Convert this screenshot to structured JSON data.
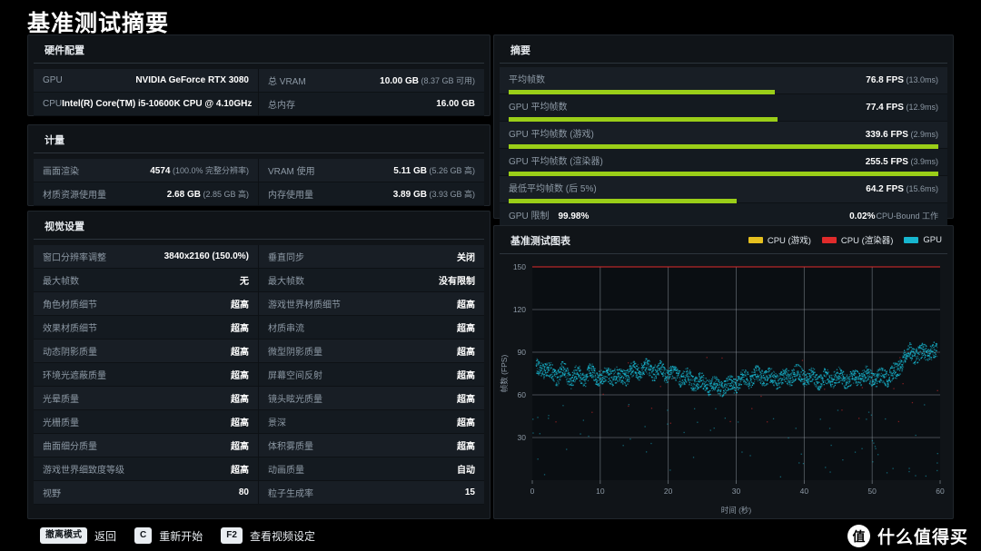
{
  "page_title": "基准测试摘要",
  "hardware": {
    "title": "硬件配置",
    "rows": [
      {
        "k": "GPU",
        "v": "NVIDIA GeForce RTX 3080",
        "sub": ""
      },
      {
        "k": "总 VRAM",
        "v": "10.00 GB",
        "sub": "(8.37 GB 可用)"
      },
      {
        "k": "CPU",
        "v": "Intel(R) Core(TM) i5-10600K CPU @ 4.10GHz",
        "sub": ""
      },
      {
        "k": "总内存",
        "v": "16.00 GB",
        "sub": ""
      }
    ]
  },
  "metrics": {
    "title": "计量",
    "rows": [
      {
        "k": "画面渲染",
        "v": "4574",
        "sub": "(100.0% 完整分辨率)"
      },
      {
        "k": "VRAM 使用",
        "v": "5.11 GB",
        "sub": "(5.26 GB 高)"
      },
      {
        "k": "材质资源使用量",
        "v": "2.68 GB",
        "sub": "(2.85 GB 高)"
      },
      {
        "k": "内存使用量",
        "v": "3.89 GB",
        "sub": "(3.93 GB 高)"
      }
    ]
  },
  "visual": {
    "title": "视觉设置",
    "rows": [
      {
        "k": "窗口分辨率调整",
        "v": "3840x2160 (150.0%)",
        "sub": ""
      },
      {
        "k": "垂直同步",
        "v": "关闭",
        "sub": ""
      },
      {
        "k": "最大帧数",
        "v": "无",
        "sub": ""
      },
      {
        "k": "最大帧数",
        "v": "没有限制",
        "sub": ""
      },
      {
        "k": "角色材质细节",
        "v": "超高",
        "sub": ""
      },
      {
        "k": "游戏世界材质细节",
        "v": "超高",
        "sub": ""
      },
      {
        "k": "效果材质细节",
        "v": "超高",
        "sub": ""
      },
      {
        "k": "材质串流",
        "v": "超高",
        "sub": ""
      },
      {
        "k": "动态阴影质量",
        "v": "超高",
        "sub": ""
      },
      {
        "k": "微型阴影质量",
        "v": "超高",
        "sub": ""
      },
      {
        "k": "环境光遮蔽质量",
        "v": "超高",
        "sub": ""
      },
      {
        "k": "屏幕空间反射",
        "v": "超高",
        "sub": ""
      },
      {
        "k": "光晕质量",
        "v": "超高",
        "sub": ""
      },
      {
        "k": "镜头眩光质量",
        "v": "超高",
        "sub": ""
      },
      {
        "k": "光栅质量",
        "v": "超高",
        "sub": ""
      },
      {
        "k": "景深",
        "v": "超高",
        "sub": ""
      },
      {
        "k": "曲面细分质量",
        "v": "超高",
        "sub": ""
      },
      {
        "k": "体积雾质量",
        "v": "超高",
        "sub": ""
      },
      {
        "k": "游戏世界细致度等级",
        "v": "超高",
        "sub": ""
      },
      {
        "k": "动画质量",
        "v": "自动",
        "sub": ""
      },
      {
        "k": "视野",
        "v": "80",
        "sub": ""
      },
      {
        "k": "粒子生成率",
        "v": "15",
        "sub": ""
      }
    ]
  },
  "summary": {
    "title": "摘要",
    "rows": [
      {
        "label": "平均帧数",
        "value": "76.8 FPS",
        "ms": "(13.0ms)",
        "pct": "",
        "bar": 62.0,
        "color": "green"
      },
      {
        "label": "GPU 平均帧数",
        "value": "77.4 FPS",
        "ms": "(12.9ms)",
        "pct": "",
        "bar": 62.5,
        "color": "green"
      },
      {
        "label": "GPU 平均帧数 (游戏)",
        "value": "339.6 FPS",
        "ms": "(2.9ms)",
        "pct": "",
        "bar": 100.0,
        "color": "green"
      },
      {
        "label": "GPU 平均帧数 (渲染器)",
        "value": "255.5 FPS",
        "ms": "(3.9ms)",
        "pct": "",
        "bar": 100.0,
        "color": "green"
      },
      {
        "label": "最低平均帧数 (后 5%)",
        "value": "64.2 FPS",
        "ms": "(15.6ms)",
        "pct": "",
        "bar": 53.0,
        "color": "green"
      },
      {
        "label": "GPU 限制",
        "value": "0.02%",
        "ms": "",
        "pct": "99.98%",
        "cpu_bound": "CPU-Bound 工作",
        "bar": 100.0,
        "color": "cyan"
      }
    ]
  },
  "chart": {
    "title": "基准测试图表",
    "legend": [
      {
        "name": "CPU (游戏)",
        "color": "#e6c01f"
      },
      {
        "name": "CPU (渲染器)",
        "color": "#e02b2b"
      },
      {
        "name": "GPU",
        "color": "#17b6cf"
      }
    ]
  },
  "chart_data": {
    "type": "scatter",
    "title": "基准测试图表",
    "xlabel": "时间 (秒)",
    "ylabel": "帧数 (FPS)",
    "xlim": [
      0,
      60
    ],
    "ylim": [
      0,
      150
    ],
    "xticks": [
      0,
      10,
      20,
      30,
      40,
      50,
      60
    ],
    "yticks": [
      0,
      30,
      60,
      90,
      120,
      150
    ],
    "grid": true,
    "legend_position": "top-right",
    "series": [
      {
        "name": "GPU",
        "color": "#17b6cf",
        "note": "密集散点，围绕 65-90 FPS 波动，结尾升至约 90 FPS",
        "x": [
          0.5,
          1.5,
          2.5,
          3.5,
          4.5,
          5.5,
          6.5,
          7.5,
          8.5,
          9.5,
          10.5,
          11.5,
          12.5,
          13.5,
          14.5,
          15.5,
          16.5,
          17.5,
          18.5,
          19.5,
          20.5,
          21.5,
          22.5,
          23.5,
          24.5,
          25.5,
          26.5,
          27.5,
          28.5,
          29.5,
          30.5,
          31.5,
          32.5,
          33.5,
          34.5,
          35.5,
          36.5,
          37.5,
          38.5,
          39.5,
          40.5,
          41.5,
          42.5,
          43.5,
          44.5,
          45.5,
          46.5,
          47.5,
          48.5,
          49.5,
          50.5,
          51.5,
          52.5,
          53.5,
          54.5,
          55.5,
          56.5,
          57.5,
          58.5,
          59.5
        ],
        "y": [
          78,
          80,
          76,
          74,
          77,
          72,
          75,
          73,
          76,
          74,
          72,
          75,
          73,
          74,
          76,
          78,
          79,
          78,
          77,
          76,
          75,
          74,
          72,
          70,
          69,
          68,
          67,
          66,
          67,
          68,
          70,
          72,
          73,
          74,
          73,
          72,
          71,
          73,
          75,
          74,
          73,
          72,
          71,
          72,
          73,
          72,
          71,
          72,
          74,
          73,
          72,
          73,
          74,
          76,
          86,
          90,
          89,
          90,
          91,
          90
        ]
      },
      {
        "name": "CPU (游戏)",
        "color": "#e6c01f",
        "note": "极稀疏离群点",
        "x": [],
        "y": []
      },
      {
        "name": "CPU (渲染器)",
        "color": "#e02b2b",
        "note": "约 150 FPS 的上限平线与零星离群点",
        "x": [
          0,
          60
        ],
        "y": [
          150,
          150
        ]
      }
    ]
  },
  "footer": {
    "actions": [
      {
        "key": "撤离模式",
        "label": "返回"
      },
      {
        "key": "C",
        "label": "重新开始"
      },
      {
        "key": "F2",
        "label": "查看视频设定"
      }
    ]
  },
  "watermark": {
    "logo": "值",
    "text": "什么值得买"
  }
}
